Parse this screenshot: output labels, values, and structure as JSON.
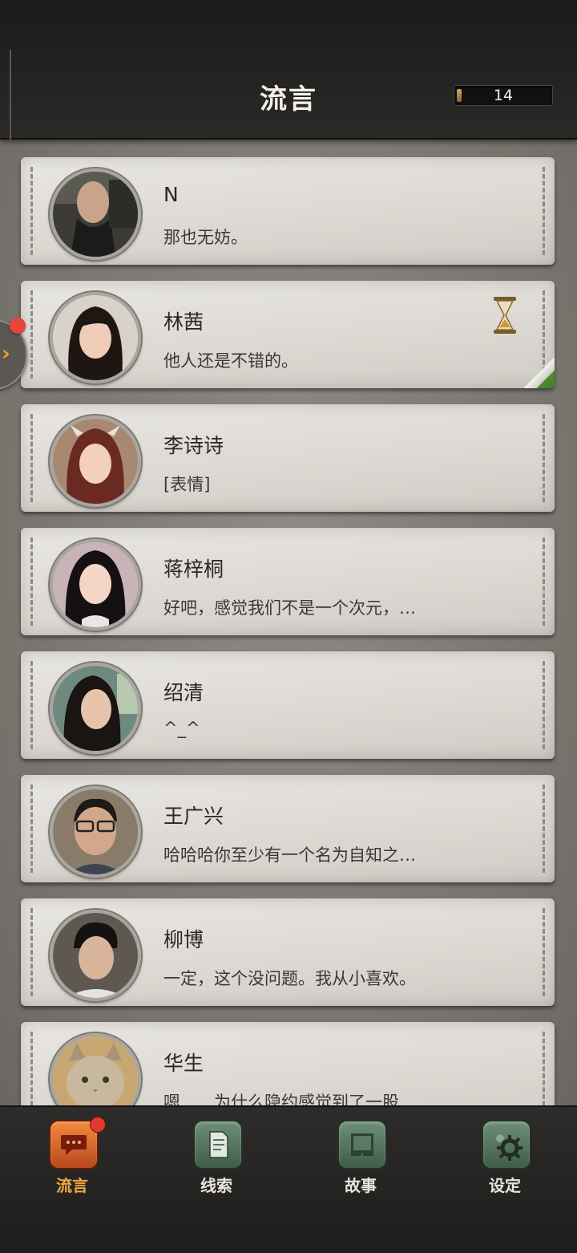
{
  "header": {
    "title": "流言",
    "counter": "14",
    "counter_progress": 0.05
  },
  "contacts": [
    {
      "name": "N",
      "message": "那也无妨。"
    },
    {
      "name": "林茜",
      "message": "他人还是不错的。",
      "status_icon": "hourglass-icon",
      "unread": true
    },
    {
      "name": "李诗诗",
      "message": "[表情]"
    },
    {
      "name": "蒋梓桐",
      "message": "好吧，感觉我们不是一个次元，…"
    },
    {
      "name": "绍清",
      "message": "^_^"
    },
    {
      "name": "王广兴",
      "message": "哈哈哈你至少有一个名为自知之…"
    },
    {
      "name": "柳博",
      "message": "一定，这个没问题。我从小喜欢。"
    },
    {
      "name": "华生",
      "message": "嗯……为什么隐约感觉到了一股…"
    }
  ],
  "side_tab": {
    "icon": "chevron-right-icon",
    "arrow": "›"
  },
  "nav": {
    "items": [
      {
        "label": "流言",
        "icon": "chat-icon",
        "active": true,
        "badge": true
      },
      {
        "label": "线索",
        "icon": "document-icon"
      },
      {
        "label": "故事",
        "icon": "book-icon"
      },
      {
        "label": "设定",
        "icon": "gear-icon"
      }
    ]
  },
  "colors": {
    "accent": "#f0a840",
    "badge": "#e23a2e",
    "nav_active": "#d8642a",
    "nav_inactive": "#5a7a64"
  }
}
